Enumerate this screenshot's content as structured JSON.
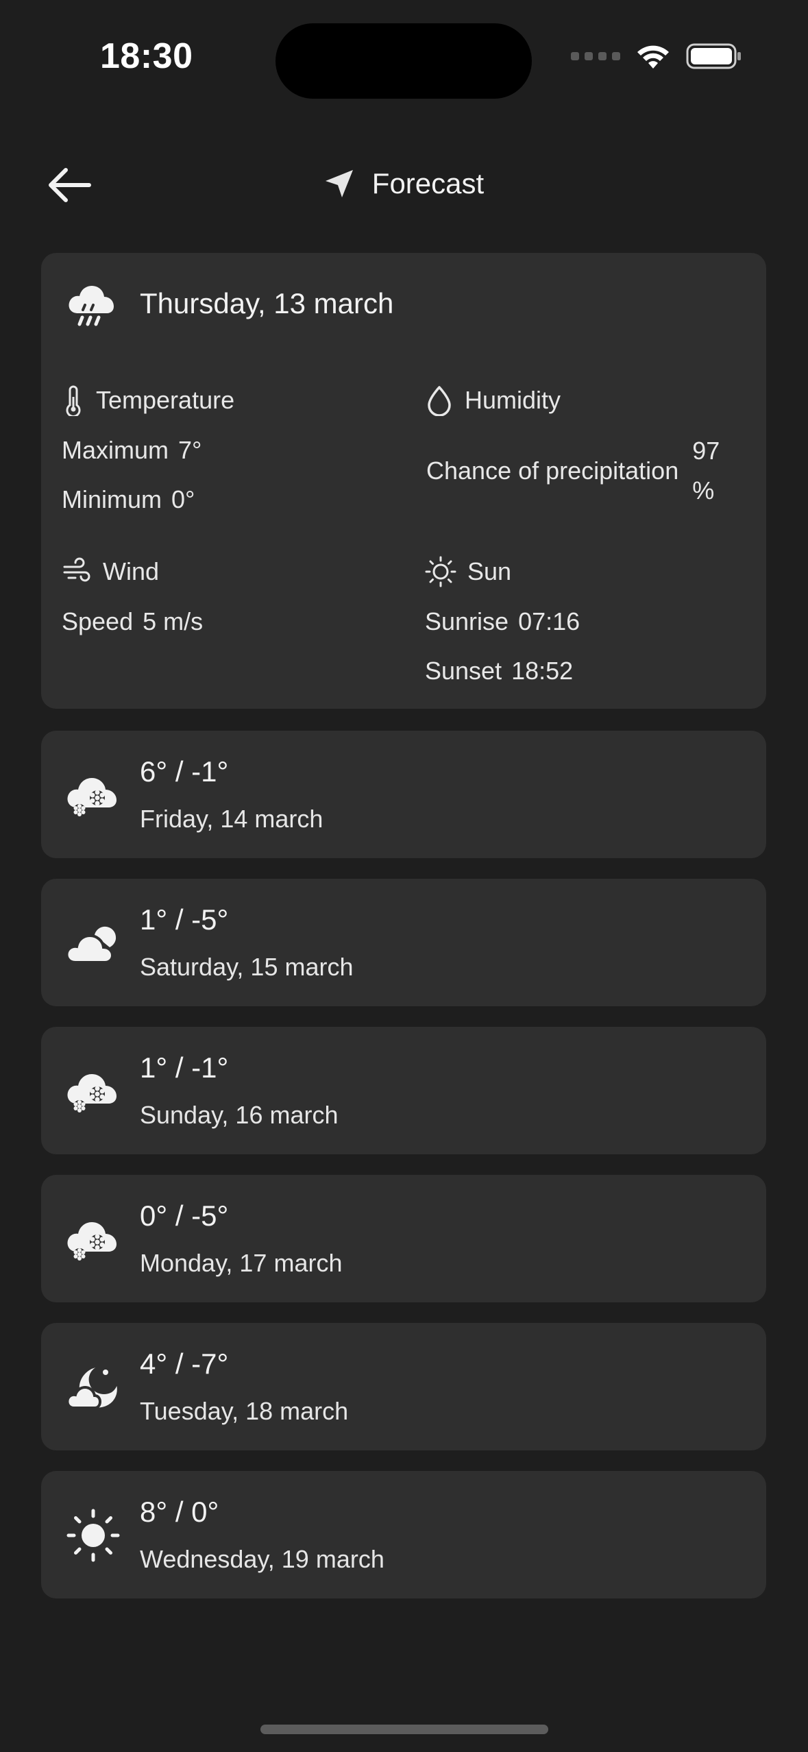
{
  "status_bar": {
    "time": "18:30",
    "icons": [
      "signal-dots-icon",
      "wifi-icon",
      "battery-icon"
    ]
  },
  "header": {
    "title": "Forecast",
    "back_icon": "arrow-left-icon",
    "location_icon": "navigation-arrow-icon"
  },
  "today": {
    "icon": "cloud-rain-icon",
    "date": "Thursday, 13 march",
    "temperature": {
      "title": "Temperature",
      "icon": "thermometer-icon",
      "max_label": "Maximum",
      "max_value": "7°",
      "min_label": "Minimum",
      "min_value": "0°"
    },
    "humidity": {
      "title": "Humidity",
      "icon": "droplet-icon",
      "precip_label": "Chance of precipitation",
      "precip_value": "97 %"
    },
    "wind": {
      "title": "Wind",
      "icon": "wind-icon",
      "speed_label": "Speed",
      "speed_value": "5 m/s"
    },
    "sun": {
      "title": "Sun",
      "icon": "sun-outline-icon",
      "sunrise_label": "Sunrise",
      "sunrise_value": "07:16",
      "sunset_label": "Sunset",
      "sunset_value": "18:52"
    }
  },
  "days": [
    {
      "temp": "6° / -1°",
      "date": "Friday, 14 march",
      "icon": "cloud-snow-icon"
    },
    {
      "temp": "1° / -5°",
      "date": "Saturday, 15 march",
      "icon": "cloudy-icon"
    },
    {
      "temp": "1° / -1°",
      "date": "Sunday, 16 march",
      "icon": "cloud-snow-icon"
    },
    {
      "temp": "0° / -5°",
      "date": "Monday, 17 march",
      "icon": "cloud-snow-icon"
    },
    {
      "temp": "4° / -7°",
      "date": "Tuesday, 18 march",
      "icon": "moon-cloud-icon"
    },
    {
      "temp": "8° / 0°",
      "date": "Wednesday, 19 march",
      "icon": "sun-icon"
    }
  ],
  "colors": {
    "background": "#1e1e1e",
    "card": "#2f2f2f",
    "text": "#f2f2f2"
  }
}
